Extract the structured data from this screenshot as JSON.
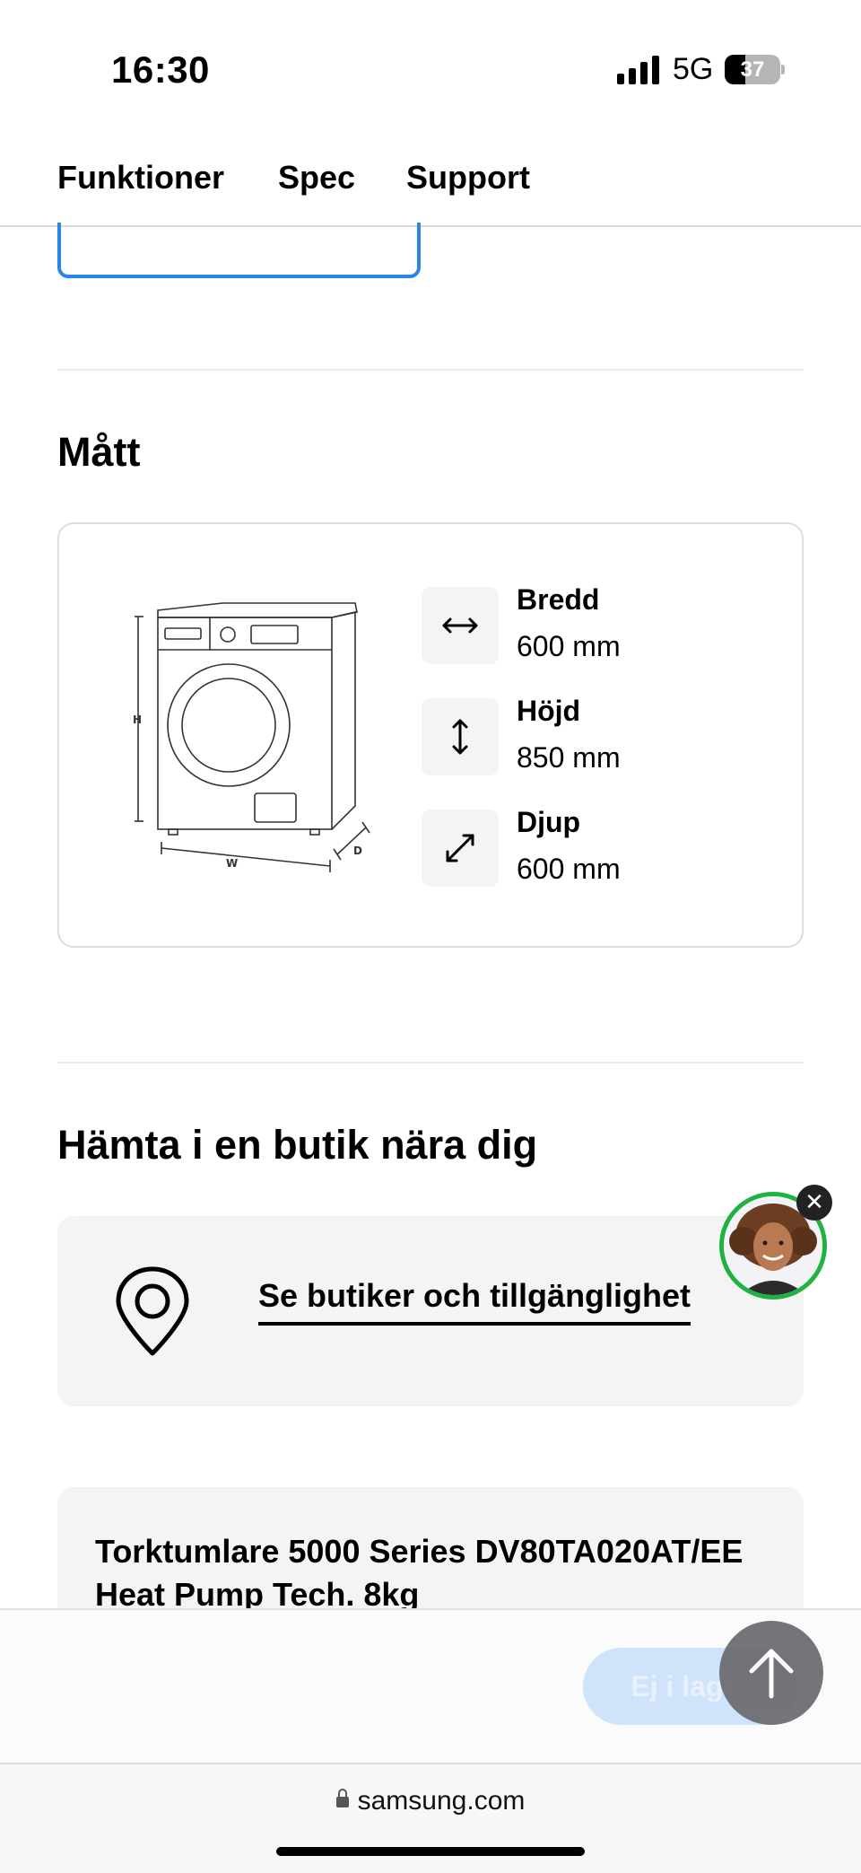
{
  "status_bar": {
    "time": "16:30",
    "network": "5G",
    "battery": "37",
    "battery_level": 0.37
  },
  "tabs": [
    {
      "label": "Funktioner"
    },
    {
      "label": "Spec"
    },
    {
      "label": "Support"
    }
  ],
  "dimensions": {
    "title": "Mått",
    "diagram_labels": {
      "height": "H",
      "width": "W",
      "depth": "D"
    },
    "items": [
      {
        "label": "Bredd",
        "value": "600 mm",
        "icon": "horizontal-arrows-icon"
      },
      {
        "label": "Höjd",
        "value": "850 mm",
        "icon": "vertical-arrows-icon"
      },
      {
        "label": "Djup",
        "value": "600 mm",
        "icon": "diagonal-arrows-icon"
      }
    ]
  },
  "store": {
    "title": "Hämta i en butik nära dig",
    "link": "Se butiker och tillgänglighet",
    "icon": "location-pin-icon"
  },
  "product": {
    "title": "Torktumlare  5000 Series DV80TA020AT/EE Heat Pump Tech. 8kg"
  },
  "bottom_bar": {
    "stock_button": "Ej i lager"
  },
  "browser": {
    "url": "samsung.com"
  },
  "colors": {
    "accent_blue": "#2a86e6",
    "chat_ring": "#1fb141",
    "stock_button_bg": "#cfe3fb"
  }
}
